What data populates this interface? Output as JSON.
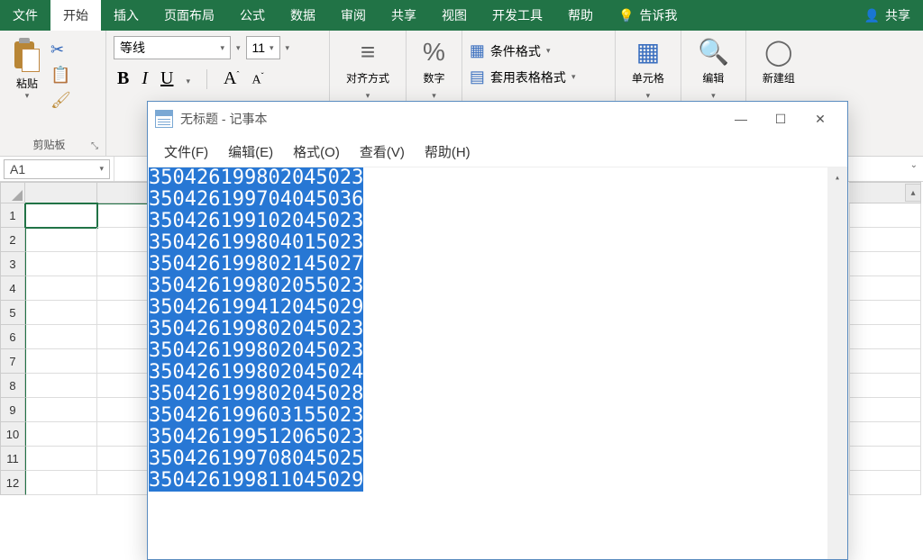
{
  "excel": {
    "tabs": [
      "文件",
      "开始",
      "插入",
      "页面布局",
      "公式",
      "数据",
      "审阅",
      "共享",
      "视图",
      "开发工具",
      "帮助"
    ],
    "tellme": "告诉我",
    "share": "共享",
    "active_tab": "开始",
    "clipboard": {
      "paste": "粘贴",
      "title": "剪贴板"
    },
    "font": {
      "name": "等线",
      "size": "11"
    },
    "align_title": "对齐方式",
    "number_title": "数字",
    "number_pct": "%",
    "styles": {
      "cond": "条件格式",
      "tablefmt": "套用表格格式"
    },
    "cells": "单元格",
    "edit": "编辑",
    "new_group": "新建组",
    "namebox": "A1",
    "row_headers": [
      1,
      2,
      3,
      4,
      5,
      6,
      7,
      8,
      9,
      10,
      11,
      12
    ]
  },
  "notepad": {
    "title": "无标题 - 记事本",
    "menus": [
      "文件(F)",
      "编辑(E)",
      "格式(O)",
      "查看(V)",
      "帮助(H)"
    ],
    "lines": [
      "350426199802045023",
      "350426199704045036",
      "350426199102045023",
      "350426199804015023",
      "350426199802145027",
      "350426199802055023",
      "350426199412045029",
      "350426199802045023",
      "350426199802045023",
      "350426199802045024",
      "350426199802045028",
      "350426199603155023",
      "350426199512065023",
      "350426199708045025",
      "350426199811045029"
    ],
    "win": {
      "min": "—",
      "max": "☐",
      "close": "✕"
    },
    "scroll_up": "▴"
  }
}
